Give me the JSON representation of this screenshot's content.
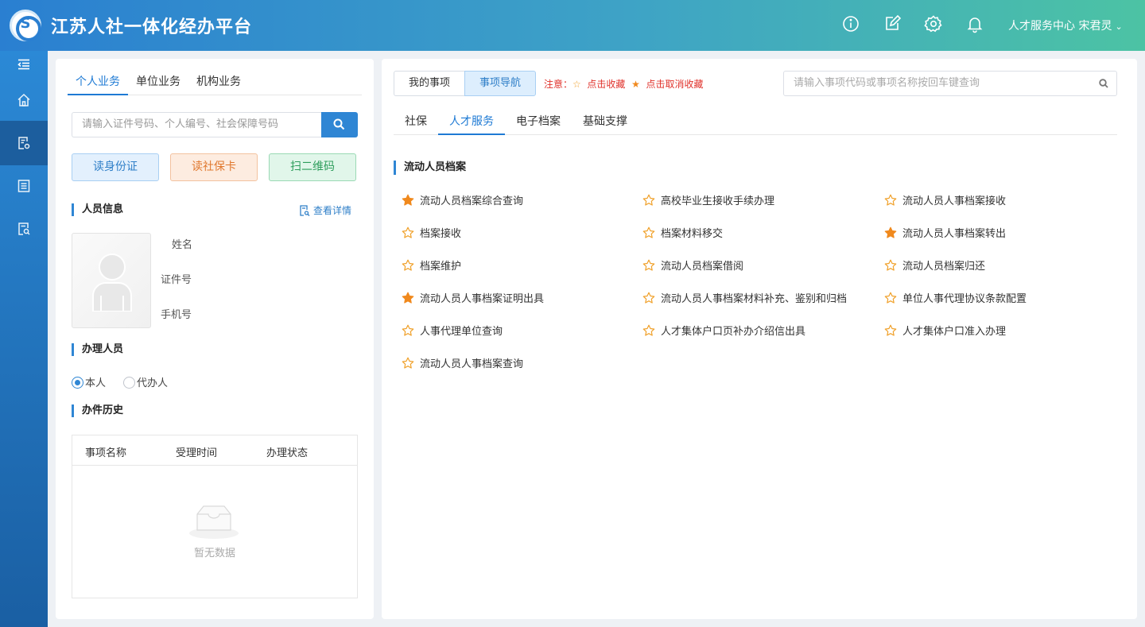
{
  "header": {
    "title": "江苏人社一体化经办平台",
    "user_label": "人才服务中心 宋君灵"
  },
  "left": {
    "tabs": [
      {
        "label": "个人业务",
        "active": true
      },
      {
        "label": "单位业务",
        "active": false
      },
      {
        "label": "机构业务",
        "active": false
      }
    ],
    "search_placeholder": "请输入证件号码、个人编号、社会保障号码",
    "buttons": {
      "read_id": "读身份证",
      "read_card": "读社保卡",
      "scan_qr": "扫二维码"
    },
    "person_info_title": "人员信息",
    "detail_link": "查看详情",
    "fields": {
      "name": "姓名",
      "id_no": "证件号",
      "phone": "手机号"
    },
    "handler_title": "办理人员",
    "handler_options": [
      {
        "label": "本人",
        "checked": true
      },
      {
        "label": "代办人",
        "checked": false
      }
    ],
    "history_title": "办件历史",
    "history_columns": [
      "事项名称",
      "受理时间",
      "办理状态"
    ],
    "history_empty": "暂无数据"
  },
  "right": {
    "segments": {
      "mine": "我的事项",
      "nav": "事项导航"
    },
    "notice": {
      "prefix": "注意：",
      "add": "点击收藏",
      "remove": "点击取消收藏"
    },
    "search_placeholder": "请输入事项代码或事项名称按回车键查询",
    "tabs": [
      {
        "label": "社保",
        "active": false
      },
      {
        "label": "人才服务",
        "active": true
      },
      {
        "label": "电子档案",
        "active": false
      },
      {
        "label": "基础支撑",
        "active": false
      }
    ],
    "category_title": "流动人员档案",
    "items": [
      {
        "label": "流动人员档案综合查询",
        "favorite": true
      },
      {
        "label": "高校毕业生接收手续办理",
        "favorite": false
      },
      {
        "label": "流动人员人事档案接收",
        "favorite": false
      },
      {
        "label": "档案接收",
        "favorite": false
      },
      {
        "label": "档案材料移交",
        "favorite": false
      },
      {
        "label": "流动人员人事档案转出",
        "favorite": true
      },
      {
        "label": "档案维护",
        "favorite": false
      },
      {
        "label": "流动人员档案借阅",
        "favorite": false
      },
      {
        "label": "流动人员档案归还",
        "favorite": false
      },
      {
        "label": "流动人员人事档案证明出具",
        "favorite": true
      },
      {
        "label": "流动人员人事档案材料补充、鉴别和归档",
        "favorite": false
      },
      {
        "label": "单位人事代理协议条款配置",
        "favorite": false
      },
      {
        "label": "人事代理单位查询",
        "favorite": false
      },
      {
        "label": "人才集体户口页补办介绍信出具",
        "favorite": false
      },
      {
        "label": "人才集体户口准入办理",
        "favorite": false
      },
      {
        "label": "流动人员人事档案查询",
        "favorite": false
      }
    ]
  },
  "colors": {
    "accent": "#2f86d4",
    "star_filled": "#f0891d",
    "star_outline": "#f0a12b"
  }
}
